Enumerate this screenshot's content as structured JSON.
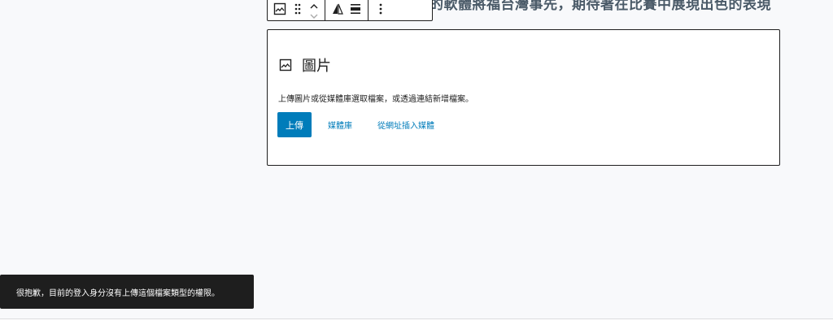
{
  "background_heading": "的軟體將福台灣事先，期待著在比賽中展現出色的表現",
  "block_toolbar": {
    "icons": [
      "image-icon",
      "drag-handle-icon",
      "chevron-up-icon",
      "chevron-down-icon",
      "align-icon",
      "justify-icon",
      "more-options-icon"
    ]
  },
  "image_block": {
    "title": "圖片",
    "instructions": "上傳圖片或從媒體庫選取檔案，或透過連結新增檔案。",
    "upload_label": "上傳",
    "media_library_label": "媒體庫",
    "insert_from_url_label": "從網址插入媒體"
  },
  "snackbar": {
    "message": "很抱歉，目前的登入身分沒有上傳這個檔案類型的權限。"
  },
  "colors": {
    "accent": "#007cba",
    "snackbar_bg": "#1e1e1e",
    "border": "#1e1e1e",
    "canvas_bg": "#f8f9fb"
  }
}
